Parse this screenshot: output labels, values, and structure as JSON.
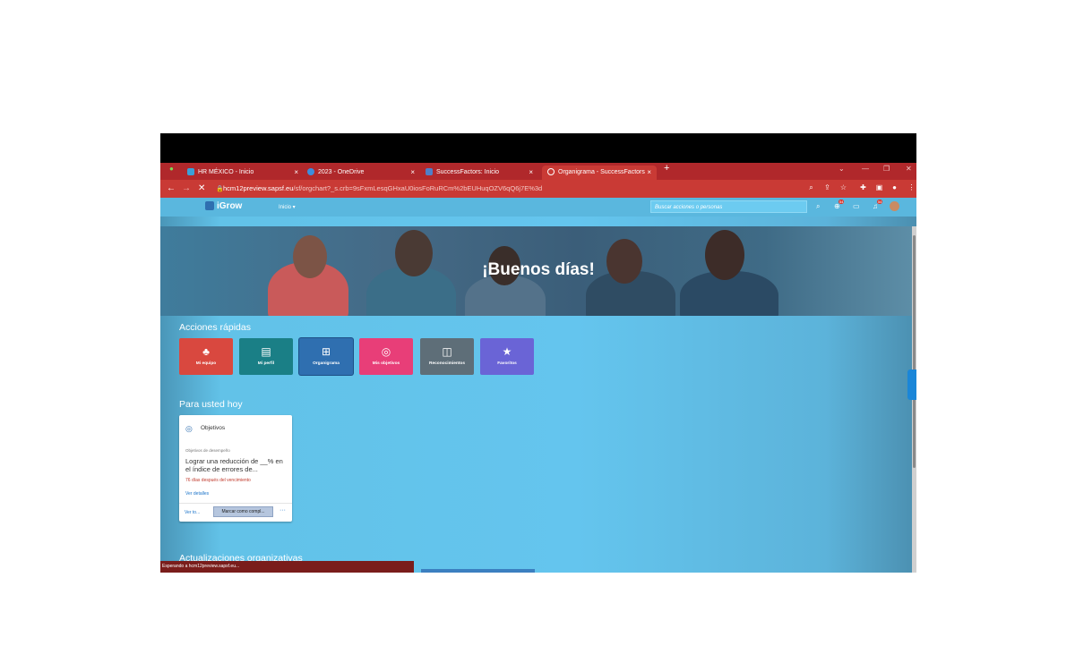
{
  "browser": {
    "tabs": [
      {
        "label": "HR MÉXICO - Inicio",
        "icon": "sap-icon"
      },
      {
        "label": "2023 - OneDrive",
        "icon": "onedrive-icon"
      },
      {
        "label": "SuccessFactors: Inicio",
        "icon": "successfactors-icon"
      },
      {
        "label": "Organigrama - SuccessFactors",
        "icon": "loading-icon"
      }
    ],
    "close_glyph": "×",
    "new_tab_glyph": "+",
    "url_host": "hcm12preview.sapsf.eu",
    "url_rest": "/sf/orgchart?_s.crb=9sFxmLesqGHxaU0iosFoRuRCm%2bEUHuqOZV6qQ6j7E%3d",
    "status_text": "Esperando a hcm12preview.sapsf.eu..."
  },
  "app": {
    "logo": "iGrow",
    "menu": "Inicio ▾",
    "search_placeholder": "Buscar acciones o personas",
    "notif_badge_1": "54",
    "notif_badge_2": "54",
    "greeting": "¡Buenos días!",
    "quick_actions_title": "Acciones rápidas",
    "quick_actions": [
      {
        "label": "Mi equipo",
        "color": "#d9483f",
        "icon": "team-icon"
      },
      {
        "label": "Mi perfil",
        "color": "#1a7f86",
        "icon": "profile-card-icon"
      },
      {
        "label": "Organigrama",
        "color": "#2f6fb0",
        "icon": "org-chart-icon"
      },
      {
        "label": "Mis objetivos",
        "color": "#e83e78",
        "icon": "target-icon"
      },
      {
        "label": "Reconocimientos",
        "color": "#5e6e78",
        "icon": "badge-icon"
      },
      {
        "label": "Favoritos",
        "color": "#6a64d6",
        "icon": "star-icon"
      }
    ],
    "today_title": "Para usted hoy",
    "card": {
      "title": "Objetivos",
      "subtitle": "Objetivos de desempeño",
      "body": "Lograr una reducción de __% en el índice de errores de...",
      "due": "76 días después del vencimiento",
      "details_link": "Ver detalles",
      "view_all": "Ver to...",
      "complete_button": "Marcar como compl...",
      "more": "···"
    },
    "org_updates_title": "Actualizaciones organizativas"
  }
}
